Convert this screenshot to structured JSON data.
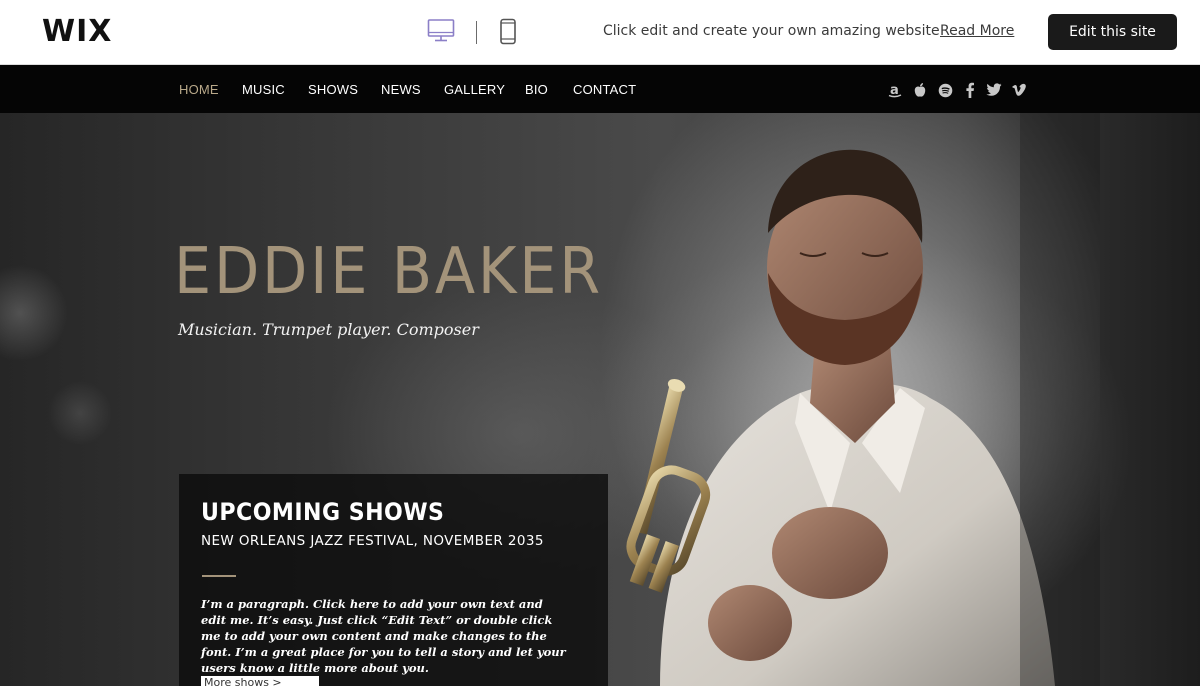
{
  "wix_bar": {
    "logo": "WIX",
    "device_desktop_icon": "desktop-icon",
    "device_mobile_icon": "mobile-icon",
    "promo_text": "Click edit and create your own amazing website",
    "read_more": "Read More",
    "edit_button": "Edit this site"
  },
  "nav": {
    "items": [
      {
        "label": "HOME",
        "active": true
      },
      {
        "label": "MUSIC",
        "active": false
      },
      {
        "label": "SHOWS",
        "active": false
      },
      {
        "label": "NEWS",
        "active": false
      },
      {
        "label": "GALLERY",
        "active": false
      },
      {
        "label": "BIO",
        "active": false
      },
      {
        "label": "CONTACT",
        "active": false
      }
    ],
    "social": [
      {
        "icon": "amazon-icon",
        "glyph": "a"
      },
      {
        "icon": "apple-icon",
        "glyph": ""
      },
      {
        "icon": "spotify-icon",
        "glyph": ""
      },
      {
        "icon": "facebook-icon",
        "glyph": "f"
      },
      {
        "icon": "twitter-icon",
        "glyph": ""
      },
      {
        "icon": "vimeo-icon",
        "glyph": "v"
      }
    ]
  },
  "hero": {
    "title": "EDDIE BAKER",
    "subtitle": "Musician. Trumpet player. Composer"
  },
  "shows": {
    "title": "UPCOMING SHOWS",
    "event": "NEW ORLEANS JAZZ FESTIVAL, NOVEMBER 2035",
    "paragraph": "I’m a paragraph. Click here to add your own text and edit me. It’s easy. Just click “Edit Text” or double click me to add your own content and make changes to the font. I’m a great place for you to tell a story and let your users know a little more about you.",
    "more_button": "More shows >"
  },
  "colors": {
    "accent_gold": "#a3937a",
    "nav_active": "#b9a98a",
    "nav_bg": "#050505",
    "edit_button_bg": "#1a1a1a",
    "desktop_icon": "#8b7fc7"
  }
}
